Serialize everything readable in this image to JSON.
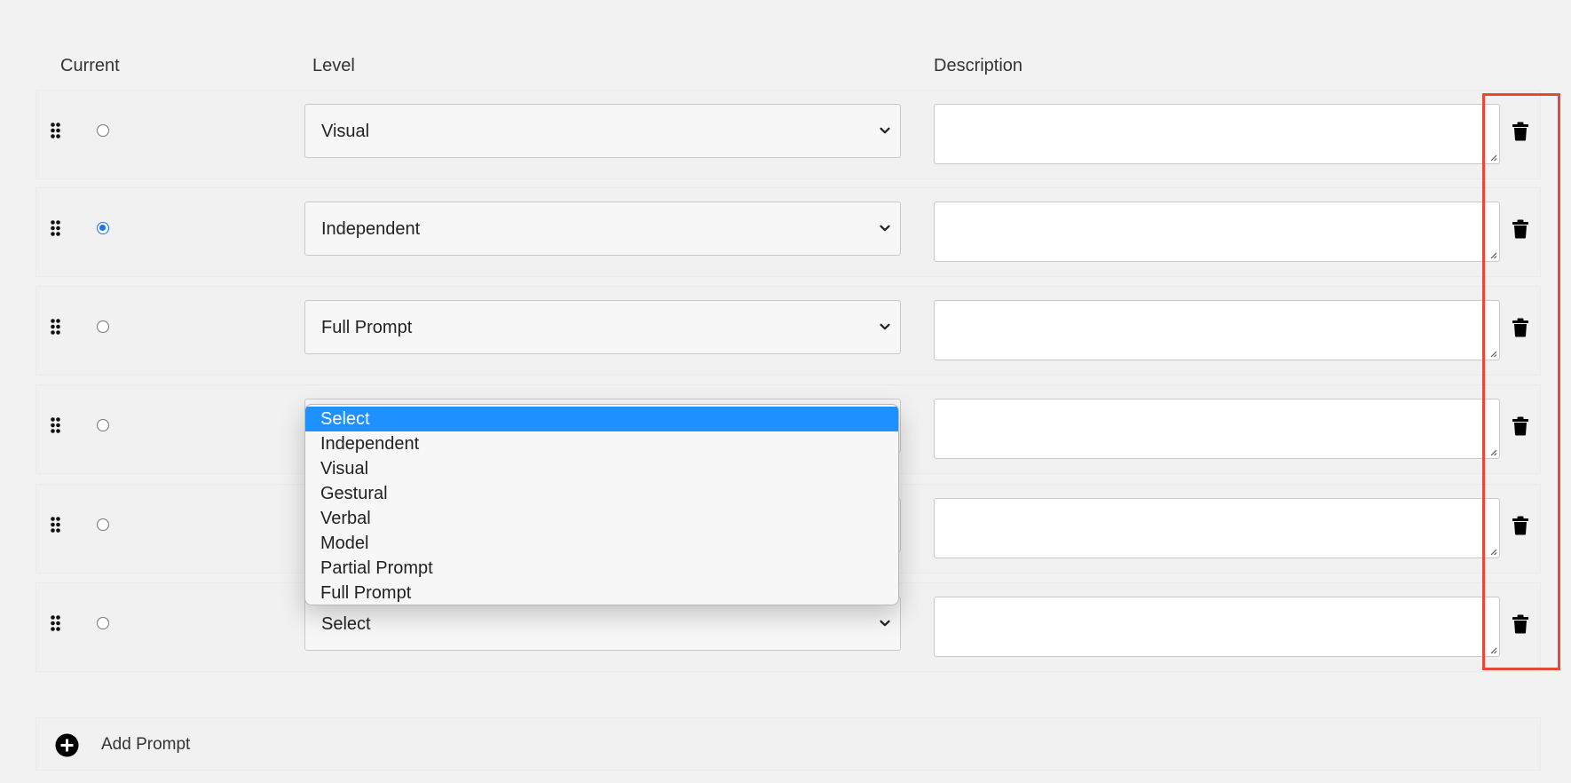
{
  "columns": {
    "current": "Current",
    "level": "Level",
    "description": "Description"
  },
  "rows": [
    {
      "current": false,
      "level": "Visual",
      "description": ""
    },
    {
      "current": true,
      "level": "Independent",
      "description": ""
    },
    {
      "current": false,
      "level": "Full Prompt",
      "description": ""
    },
    {
      "current": false,
      "level": "",
      "description": ""
    },
    {
      "current": false,
      "level": "",
      "description": ""
    },
    {
      "current": false,
      "level": "Select",
      "description": ""
    }
  ],
  "dropdown": {
    "options": [
      "Select",
      "Independent",
      "Visual",
      "Gestural",
      "Verbal",
      "Model",
      "Partial Prompt",
      "Full Prompt"
    ],
    "highlighted": "Select"
  },
  "add_prompt": {
    "label": "Add Prompt"
  },
  "icons": {
    "drag": "drag-handle-icon",
    "trash": "trash-icon",
    "chevron": "chevron-down-icon",
    "add": "plus-circle-icon",
    "resize": "resize-grip-icon"
  },
  "colors": {
    "radio_checked": "#1a73e8",
    "option_highlight": "#1e90ff",
    "highlight_box": "#e64a36",
    "panel_background": "#f2f2f2"
  }
}
